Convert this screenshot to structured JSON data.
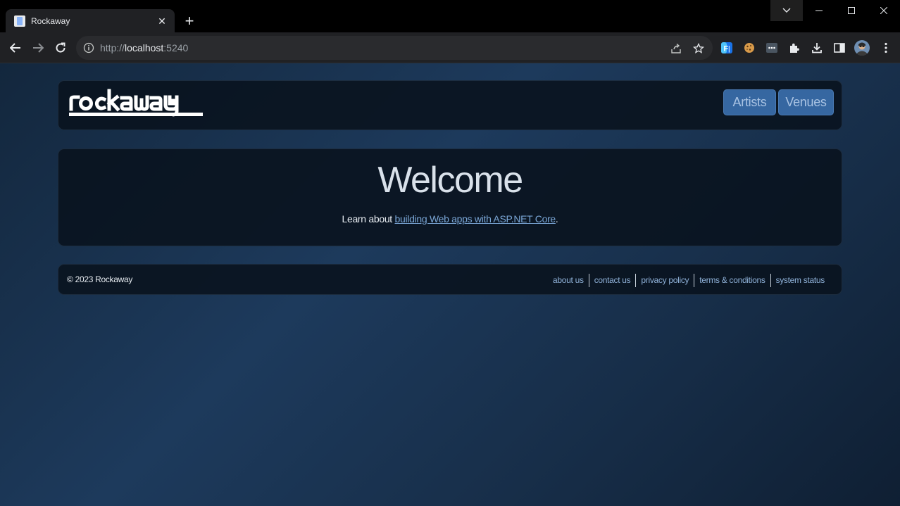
{
  "browser": {
    "tab_title": "Rockaway",
    "url_scheme": "http://",
    "url_host": "localhost",
    "url_port": ":5240"
  },
  "site": {
    "logo_text": "rockaway",
    "nav": {
      "artists_label": "Artists",
      "venues_label": "Venues"
    },
    "main": {
      "heading": "Welcome",
      "intro_prefix": "Learn about ",
      "intro_link": "building Web apps with ASP.NET Core",
      "intro_suffix": "."
    },
    "footer": {
      "copyright": "© 2023 Rockaway",
      "links": [
        "about us",
        "contact us",
        "privacy policy",
        "terms & conditions",
        "system status"
      ]
    }
  },
  "colors": {
    "nav_button": "#3667a1",
    "link": "#7aa6d6",
    "panel": "#0a1420"
  }
}
